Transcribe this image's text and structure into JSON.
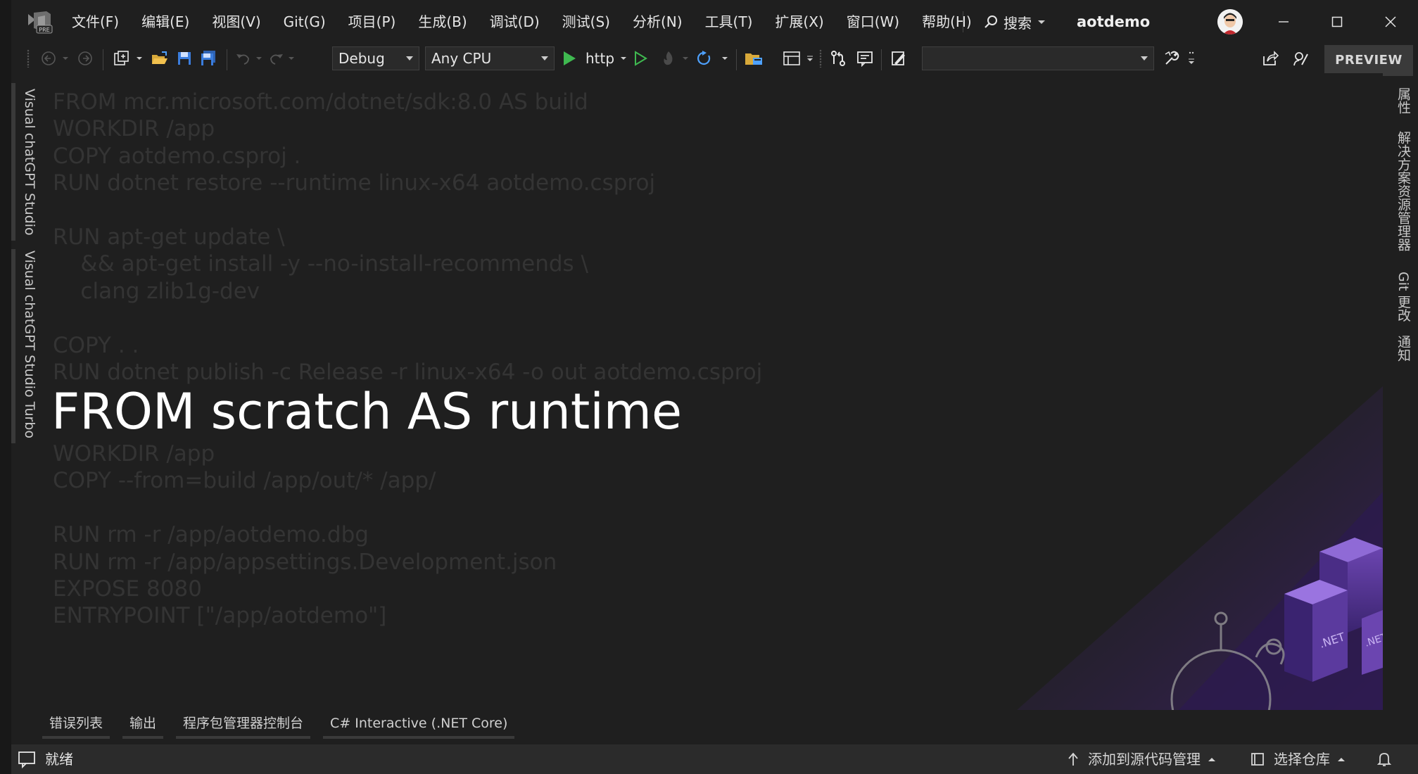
{
  "window": {
    "solution_name": "aotdemo",
    "menu": [
      "文件(F)",
      "编辑(E)",
      "视图(V)",
      "Git(G)",
      "项目(P)",
      "生成(B)",
      "调试(D)",
      "测试(S)",
      "分析(N)",
      "工具(T)",
      "扩展(X)",
      "窗口(W)",
      "帮助(H)"
    ],
    "search_label": "搜索"
  },
  "toolbar": {
    "configuration": "Debug",
    "platform": "Any CPU",
    "run_profile": "http",
    "preview_label": "PREVIEW"
  },
  "side_tabs_left": [
    "Visual chatGPT Studio",
    "Visual chatGPT Studio Turbo"
  ],
  "side_tabs_right": [
    "属性",
    "解决方案资源管理器",
    "Git 更改",
    "通知"
  ],
  "editor": {
    "lines_top": [
      "FROM mcr.microsoft.com/dotnet/sdk:8.0 AS build",
      "WORKDIR /app",
      "COPY aotdemo.csproj .",
      "RUN dotnet restore --runtime linux-x64 aotdemo.csproj",
      "",
      "RUN apt-get update \\",
      "    && apt-get install -y --no-install-recommends \\",
      "    clang zlib1g-dev",
      "",
      "COPY . .",
      "RUN dotnet publish -c Release -r linux-x64 -o out aotdemo.csproj"
    ],
    "highlight_line": "FROM scratch AS runtime",
    "lines_bottom": [
      "WORKDIR /app",
      "COPY --from=build /app/out/* /app/",
      "",
      "RUN rm -r /app/aotdemo.dbg",
      "RUN rm -r /app/appsettings.Development.json",
      "EXPOSE 8080",
      "ENTRYPOINT [\"/app/aotdemo\"]"
    ]
  },
  "bottom_tabs": [
    "错误列表",
    "输出",
    "程序包管理器控制台",
    "C# Interactive (.NET Core)"
  ],
  "status": {
    "ready": "就绪",
    "add_source_control": "添加到源代码管理",
    "select_repo": "选择仓库"
  }
}
